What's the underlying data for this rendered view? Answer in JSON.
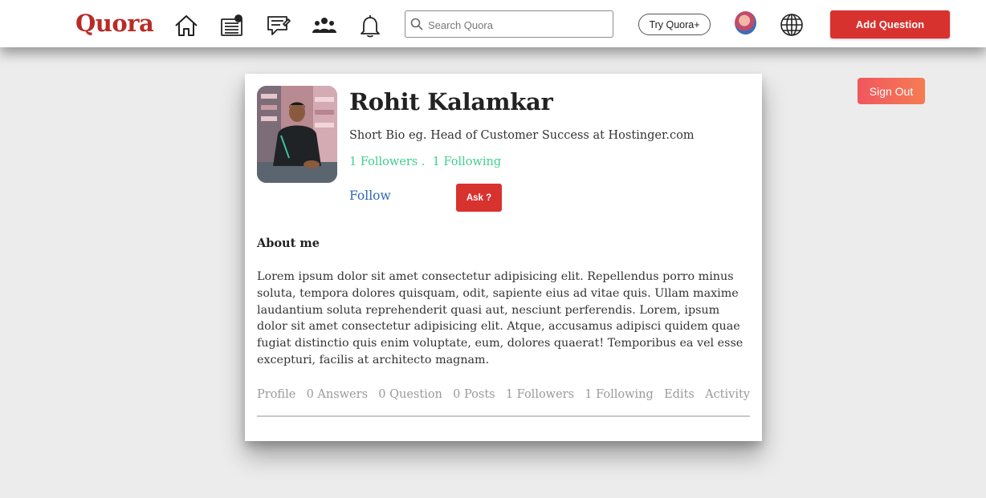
{
  "header": {
    "logo": "Quora",
    "nav_icons": [
      "home-icon",
      "news-icon",
      "answer-icon",
      "spaces-icon",
      "notifications-icon"
    ],
    "search_placeholder": "Search Quora",
    "try_label": "Try Quora+",
    "add_question_label": "Add Question",
    "accent_color": "#b92b27",
    "button_color": "#d8322f"
  },
  "sign_out_label": "Sign Out",
  "profile": {
    "name": "Rohit Kalamkar",
    "bio": "Short Bio eg. Head of Customer Success at Hostinger.com",
    "followers": "1 Followers",
    "separator": " .  ",
    "following": "1 Following",
    "follow_label": "Follow",
    "ask_label": "Ask ?",
    "about_title": "About me",
    "about_text": "Lorem ipsum dolor sit amet consectetur adipisicing elit. Repellendus porro minus soluta, tempora dolores quisquam, odit, sapiente eius ad vitae quis. Ullam maxime laudantium soluta reprehenderit quasi aut, nesciunt perferendis. Lorem, ipsum dolor sit amet consectetur adipisicing elit. Atque, accusamus adipisci quidem quae fugiat distinctio quis enim voluptate, eum, dolores quaerat! Temporibus ea vel esse excepturi, facilis at architecto magnam.",
    "stats_color": "#3fd08f",
    "link_color": "#2e69b3"
  },
  "tabs": [
    "Profile",
    "0 Answers",
    "0 Question",
    "0 Posts",
    "1 Followers",
    "1 Following",
    "Edits",
    "Activity"
  ]
}
